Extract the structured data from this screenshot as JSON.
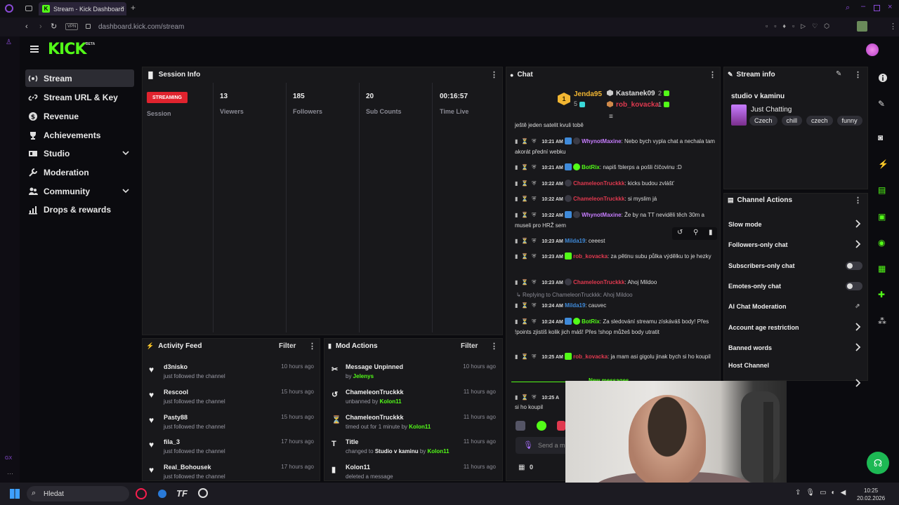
{
  "browser": {
    "tab_title": "Stream - Kick Dashboard",
    "url": "dashboard.kick.com/stream",
    "vpn": "VPN"
  },
  "header": {
    "logo": "KICK",
    "beta": "BETA"
  },
  "sidebar": {
    "items": [
      {
        "label": "Stream",
        "icon": "stream-icon"
      },
      {
        "label": "Stream URL & Key",
        "icon": "link-icon"
      },
      {
        "label": "Revenue",
        "icon": "dollar-icon"
      },
      {
        "label": "Achievements",
        "icon": "trophy-icon"
      },
      {
        "label": "Studio",
        "icon": "studio-icon"
      },
      {
        "label": "Moderation",
        "icon": "wrench-icon"
      },
      {
        "label": "Community",
        "icon": "community-icon"
      },
      {
        "label": "Drops & rewards",
        "icon": "drops-icon"
      }
    ]
  },
  "session": {
    "title": "Session Info",
    "status": "STREAMING",
    "session_label": "Session",
    "stats": [
      {
        "value": "13",
        "label": "Viewers"
      },
      {
        "value": "185",
        "label": "Followers"
      },
      {
        "value": "20",
        "label": "Sub Counts"
      },
      {
        "value": "00:16:57",
        "label": "Time Live"
      }
    ]
  },
  "activity": {
    "title": "Activity Feed",
    "filter": "Filter",
    "rows": [
      {
        "name": "d3nisko",
        "sub": "just followed the channel",
        "time": "10 hours ago"
      },
      {
        "name": "Rescool",
        "sub": "just followed the channel",
        "time": "15 hours ago"
      },
      {
        "name": "Pasty88",
        "sub": "just followed the channel",
        "time": "15 hours ago"
      },
      {
        "name": "fila_3",
        "sub": "just followed the channel",
        "time": "17 hours ago"
      },
      {
        "name": "Real_Bohousek",
        "sub": "just followed the channel",
        "time": "17 hours ago"
      }
    ]
  },
  "mod_actions": {
    "title": "Mod Actions",
    "filter": "Filter",
    "rows": [
      {
        "name": "Message Unpinned",
        "sub1": "by ",
        "sub2": "Jelenys",
        "sub3": "",
        "sub4": "",
        "time": "10 hours ago"
      },
      {
        "name": "ChameleonTruckkk",
        "sub1": "unbanned by ",
        "sub2": "Kolon11",
        "sub3": "",
        "sub4": "",
        "time": "11 hours ago"
      },
      {
        "name": "ChameleonTruckkk",
        "sub1": "timed out for 1 minute by ",
        "sub2": "Kolon11",
        "sub3": "",
        "sub4": "",
        "time": "11 hours ago"
      },
      {
        "name": "Title",
        "sub1": "changed to ",
        "sub2": "Studio v kaminu",
        "sub3": " by ",
        "sub4": "Kolon11",
        "time": "11 hours ago"
      },
      {
        "name": "Kolon11",
        "sub1": "deleted a message",
        "sub2": "",
        "sub3": "",
        "sub4": "",
        "time": "11 hours ago"
      }
    ]
  },
  "chat": {
    "title": "Chat",
    "leaders": [
      {
        "name": "Jenda95",
        "count": "5"
      },
      {
        "name": "Kastanek09",
        "count": "2"
      },
      {
        "name": "rob_kovacka",
        "count": "1"
      }
    ],
    "first_line": "ještě jeden satelit kvuli tobě",
    "messages": [
      {
        "time": "10:21 AM",
        "user": "WhynotMaxine",
        "color": "#c77dff",
        "text": "Nebo bych vypla chat a nechala tam akorát přední webku"
      },
      {
        "time": "10:21 AM",
        "user": "BotRix",
        "color": "#53fc18",
        "text": "napiš !blerps a pošli číčovinu :D"
      },
      {
        "time": "10:22 AM",
        "user": "ChameleonTruckkk",
        "color": "#e0394f",
        "text": "kicks budou zvlášť"
      },
      {
        "time": "10:22 AM",
        "user": "ChameleonTruckkk",
        "color": "#e0394f",
        "text": "si myslim já"
      },
      {
        "time": "10:22 AM",
        "user": "WhynotMaxine",
        "color": "#c77dff",
        "text": "Že by na TT neviděli těch 30m a museli pro HRŽ sem"
      },
      {
        "time": "10:23 AM",
        "user": "Milda19",
        "color": "#3f8ad9",
        "text": "ceeest"
      },
      {
        "time": "10:23 AM",
        "user": "rob_kovacka",
        "color": "#e0394f",
        "text": "za pětinu subu půlka výdělku to je hezky"
      },
      {
        "time": "10:23 AM",
        "user": "ChameleonTruckkk",
        "color": "#e0394f",
        "text": "Ahoj Mildoo"
      },
      {
        "time": "10:24 AM",
        "user": "Milda19",
        "color": "#3f8ad9",
        "text": "cauvec"
      },
      {
        "time": "10:24 AM",
        "user": "BotRix",
        "color": "#53fc18",
        "text": "Za sledování streamu získáváš body! Přes !points zjistíš kolik jich máš! Přes !shop můžeš body utratit"
      },
      {
        "time": "10:25 AM",
        "user": "rob_kovacka",
        "color": "#e0394f",
        "text": "ja mam asi gigolu jinak bych si ho koupil"
      }
    ],
    "reply_line": "Replying to ChameleonTruckkk: Ahoj Mildoo",
    "new_messages": "New messages",
    "last_time": "10:25 A",
    "last_text": "si ho koupil",
    "input_placeholder": "Send a m",
    "points": "0"
  },
  "stream_info": {
    "title": "Stream info",
    "stream_title": "studio v kaminu",
    "category": "Just Chatting",
    "tags": [
      "Czech",
      "chill",
      "czech",
      "funny"
    ]
  },
  "channel_actions": {
    "title": "Channel Actions",
    "rows": [
      {
        "label": "Slow mode"
      },
      {
        "label": "Followers-only chat"
      },
      {
        "label": "Subscribers-only chat"
      },
      {
        "label": "Emotes-only chat"
      },
      {
        "label": "AI Chat Moderation"
      },
      {
        "label": "Account age restriction"
      },
      {
        "label": "Banned words"
      },
      {
        "label": "Host Channel"
      }
    ]
  },
  "taskbar": {
    "search": "Hledat",
    "time": "10:25",
    "date": "20.02.2026"
  },
  "colors": {
    "accent": "#53fc18",
    "streaming": "#e0232e",
    "panel": "#18181b"
  }
}
